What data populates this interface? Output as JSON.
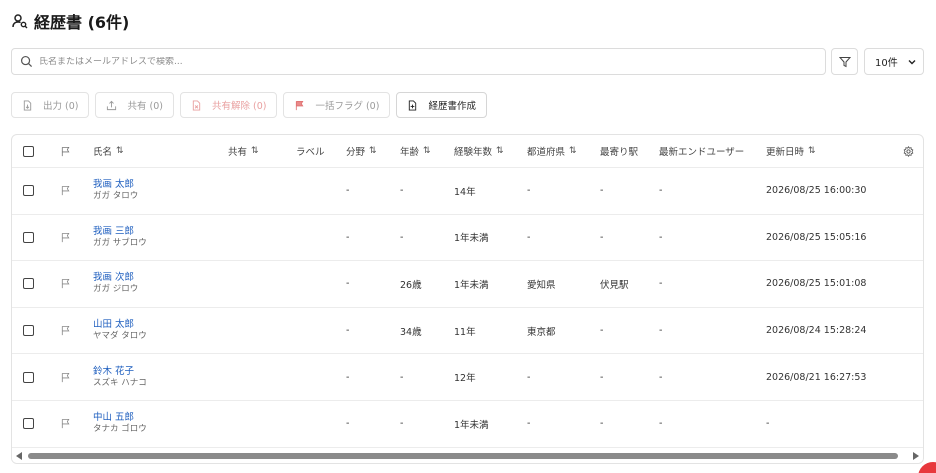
{
  "page": {
    "title": "経歴書 (6件)"
  },
  "search": {
    "placeholder": "氏名またはメールアドレスで検索..."
  },
  "per_page": {
    "selected": "10件"
  },
  "toolbar": {
    "export_label": "出力 (0)",
    "share_label": "共有 (0)",
    "unshare_label": "共有解除 (0)",
    "flag_label": "一括フラグ (0)",
    "create_label": "経歴書作成"
  },
  "table": {
    "columns": {
      "name": "氏名",
      "shared": "共有",
      "label": "ラベル",
      "field": "分野",
      "age": "年齢",
      "experience": "経験年数",
      "prefecture": "都道府県",
      "station": "最寄り駅",
      "end_user": "最新エンドユーザー",
      "updated": "更新日時"
    },
    "sort_glyph": "⇅",
    "rows": [
      {
        "name": "我画 太郎",
        "kana": "ガガ タロウ",
        "shared": "",
        "label": "",
        "field": "-",
        "age": "-",
        "experience": "14年",
        "prefecture": "-",
        "station": "-",
        "end_user": "-",
        "updated": "2026/08/25 16:00:30"
      },
      {
        "name": "我画 三郎",
        "kana": "ガガ サブロウ",
        "shared": "",
        "label": "",
        "field": "-",
        "age": "-",
        "experience": "1年未満",
        "prefecture": "-",
        "station": "-",
        "end_user": "-",
        "updated": "2026/08/25 15:05:16"
      },
      {
        "name": "我画 次郎",
        "kana": "ガガ ジロウ",
        "shared": "",
        "label": "",
        "field": "-",
        "age": "26歳",
        "experience": "1年未満",
        "prefecture": "愛知県",
        "station": "伏見駅",
        "end_user": "-",
        "updated": "2026/08/25 15:01:08"
      },
      {
        "name": "山田 太郎",
        "kana": "ヤマダ タロウ",
        "shared": "",
        "label": "",
        "field": "-",
        "age": "34歳",
        "experience": "11年",
        "prefecture": "東京都",
        "station": "-",
        "end_user": "-",
        "updated": "2026/08/24 15:28:24"
      },
      {
        "name": "鈴木 花子",
        "kana": "スズキ ハナコ",
        "shared": "",
        "label": "",
        "field": "-",
        "age": "-",
        "experience": "12年",
        "prefecture": "-",
        "station": "-",
        "end_user": "-",
        "updated": "2026/08/21 16:27:53"
      },
      {
        "name": "中山 五郎",
        "kana": "タナカ ゴロウ",
        "shared": "",
        "label": "",
        "field": "-",
        "age": "-",
        "experience": "1年未満",
        "prefecture": "-",
        "station": "-",
        "end_user": "-",
        "updated": "-"
      }
    ]
  },
  "colors": {
    "link": "#1f5fbf",
    "danger_text": "#e9a0a0",
    "accent_dot": "#e8383d"
  },
  "icons": {
    "title": "user-search-icon",
    "search": "search-icon",
    "filter": "filter-icon",
    "settings": "gear-icon",
    "flag": "flag-icon"
  }
}
